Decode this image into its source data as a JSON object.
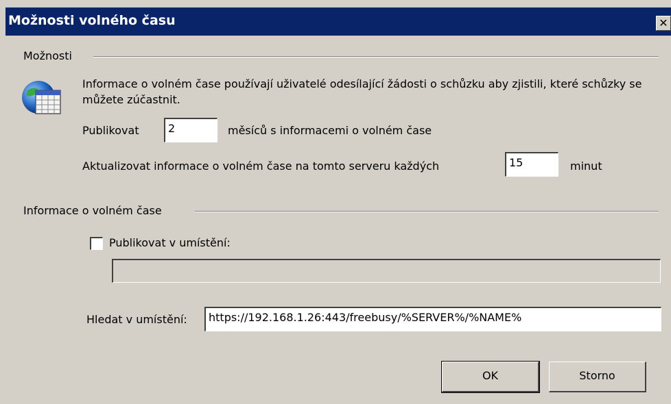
{
  "window": {
    "title": "Možnosti volného času",
    "close_glyph": "✕"
  },
  "options_group": {
    "label": "Možnosti",
    "description": "Informace o volném čase používají uživatelé odesílající žádosti o schůzku aby zjistili, které schůzky se můžete zúčastnit.",
    "icon": "calendar-globe-icon",
    "publish_label": "Publikovat",
    "publish_value": "2",
    "publish_suffix": "měsíců s informacemi o volném čase",
    "update_label": "Aktualizovat informace o volném čase na tomto serveru každých",
    "update_value": "15",
    "update_suffix": "minut"
  },
  "freebusy_group": {
    "label": "Informace o volném čase",
    "publish_at_label": "Publikovat v umístění:",
    "publish_at_checked": false,
    "publish_at_value": "",
    "search_at_label": "Hledat v umístění:",
    "search_at_value": "https://192.168.1.26:443/freebusy/%SERVER%/%NAME%"
  },
  "buttons": {
    "ok": "OK",
    "cancel": "Storno"
  }
}
